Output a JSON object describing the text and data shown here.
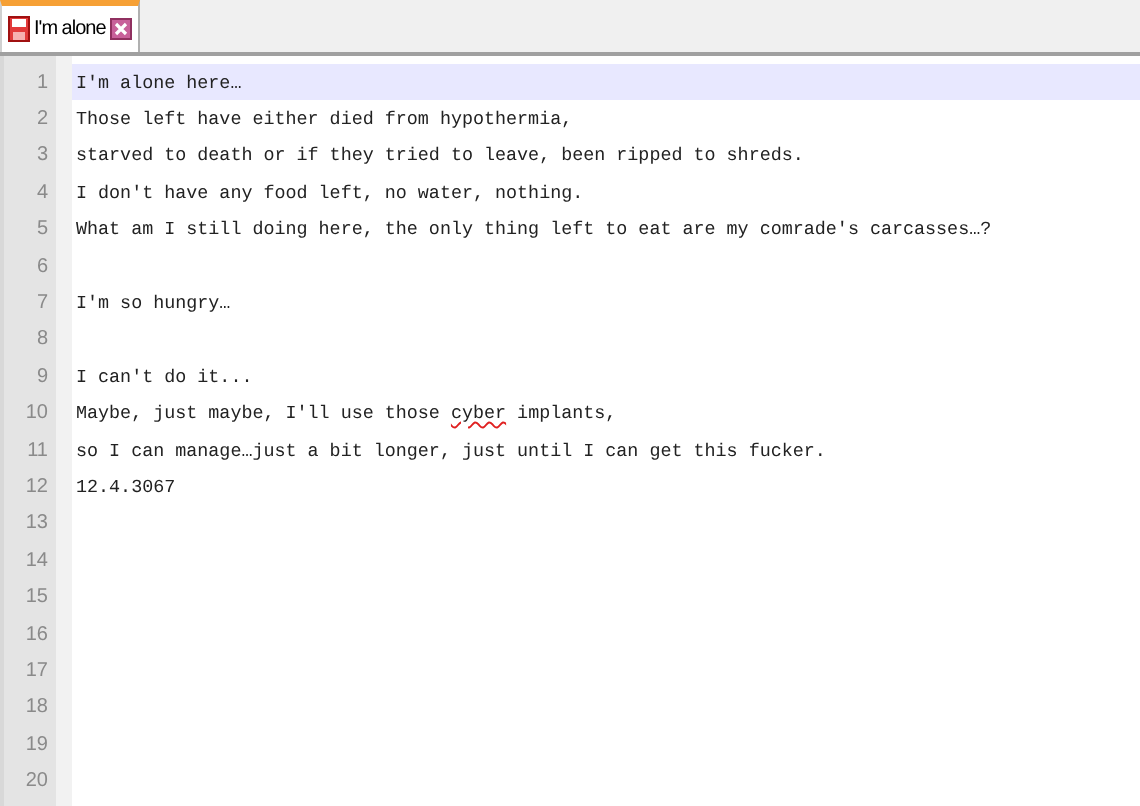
{
  "tabs": [
    {
      "label": "I'm alone",
      "selected": true,
      "modified": true
    }
  ],
  "editor": {
    "lines": [
      {
        "number": "1",
        "current": true,
        "parts": [
          {
            "text": "I'm alone here…",
            "misspelled": false
          }
        ]
      },
      {
        "number": "2",
        "current": false,
        "parts": [
          {
            "text": "Those left have either died from hypothermia,",
            "misspelled": false
          }
        ]
      },
      {
        "number": "3",
        "current": false,
        "parts": [
          {
            "text": "starved to death or if they tried to leave, been ripped to shreds.",
            "misspelled": false
          }
        ]
      },
      {
        "number": "4",
        "current": false,
        "parts": [
          {
            "text": "I don't have any food left, no water, nothing.",
            "misspelled": false
          }
        ]
      },
      {
        "number": "5",
        "current": false,
        "parts": [
          {
            "text": "What am I still doing here, the only thing left to eat are my comrade's carcasses…?",
            "misspelled": false
          }
        ]
      },
      {
        "number": "6",
        "current": false
      },
      {
        "number": "7",
        "current": false,
        "parts": [
          {
            "text": "I'm so hungry…",
            "misspelled": false
          }
        ]
      },
      {
        "number": "8",
        "current": false
      },
      {
        "number": "9",
        "current": false,
        "parts": [
          {
            "text": "I can't do it...",
            "misspelled": false
          }
        ]
      },
      {
        "number": "10",
        "current": false,
        "parts": [
          {
            "text": "Maybe, just maybe, I'll use those ",
            "misspelled": false
          },
          {
            "text": "cyber",
            "misspelled": true
          },
          {
            "text": " implants,",
            "misspelled": false
          }
        ]
      },
      {
        "number": "11",
        "current": false,
        "parts": [
          {
            "text": "so I can manage…just a bit longer, just until I can get this fucker.",
            "misspelled": false
          }
        ]
      },
      {
        "number": "12",
        "current": false,
        "parts": [
          {
            "text": "12.4.3067",
            "misspelled": false
          }
        ]
      },
      {
        "number": "13",
        "current": false
      },
      {
        "number": "14",
        "current": false
      },
      {
        "number": "15",
        "current": false
      },
      {
        "number": "16",
        "current": false
      },
      {
        "number": "17",
        "current": false
      },
      {
        "number": "18",
        "current": false
      },
      {
        "number": "19",
        "current": false
      },
      {
        "number": "20",
        "current": false
      }
    ]
  }
}
